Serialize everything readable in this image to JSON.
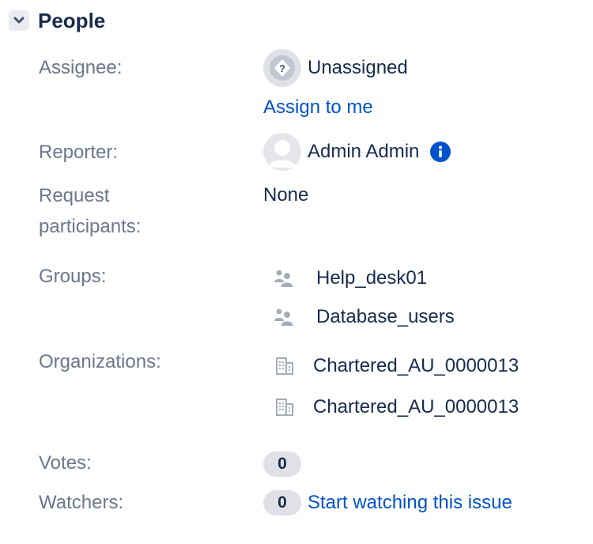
{
  "header": {
    "title": "People"
  },
  "assignee": {
    "label": "Assignee:",
    "value": "Unassigned",
    "assign_link": "Assign to me"
  },
  "reporter": {
    "label": "Reporter:",
    "value": "Admin Admin"
  },
  "request_participants": {
    "label_line1": "Request",
    "label_line2": "participants:",
    "value": "None"
  },
  "groups": {
    "label": "Groups:",
    "items": [
      "Help_desk01",
      "Database_users"
    ]
  },
  "organizations": {
    "label": "Organizations:",
    "items": [
      "Chartered_AU_0000013",
      "Chartered_AU_0000013"
    ]
  },
  "votes": {
    "label": "Votes:",
    "count": "0"
  },
  "watchers": {
    "label": "Watchers:",
    "count": "0",
    "watch_link": "Start watching this issue"
  },
  "colors": {
    "text": "#172b4d",
    "label": "#6b778c",
    "link": "#0052cc",
    "badge_bg": "#dfe1e6",
    "icon": "#a5adba"
  }
}
